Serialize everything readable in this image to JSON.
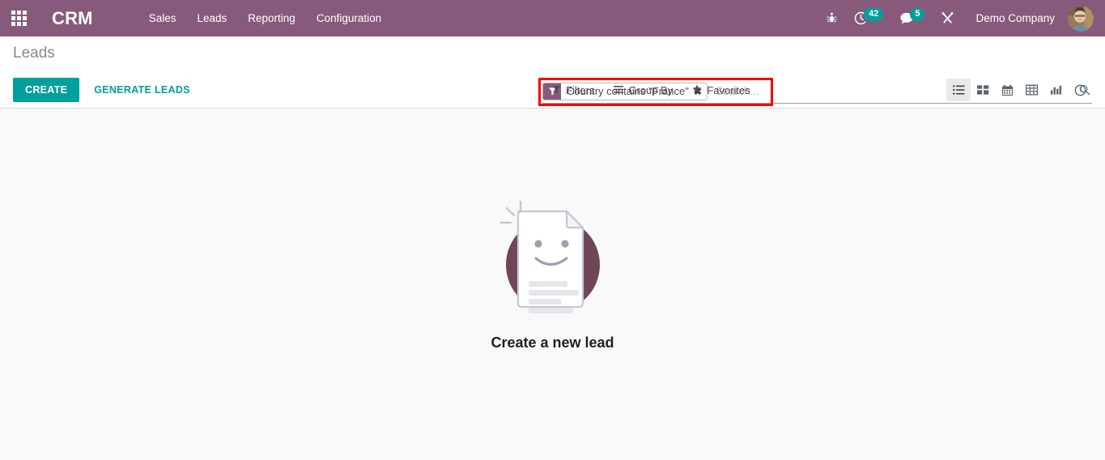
{
  "navbar": {
    "apps_icon": "apps-grid-icon",
    "brand": "CRM",
    "menu": [
      {
        "label": "Sales"
      },
      {
        "label": "Leads"
      },
      {
        "label": "Reporting"
      },
      {
        "label": "Configuration"
      }
    ],
    "systray": {
      "debug_icon": "bug-icon",
      "activity_icon": "clock-icon",
      "activity_count": "42",
      "messaging_icon": "chat-bubble-icon",
      "messaging_count": "5",
      "tools_icon": "wrench-tools-icon",
      "company": "Demo Company",
      "avatar_icon": "user-avatar"
    },
    "background_color": "#875a7b",
    "badge_color": "#00a09d"
  },
  "control_panel": {
    "breadcrumb": "Leads",
    "buttons": {
      "create": "CREATE",
      "generate_leads": "GENERATE LEADS",
      "create_color": "#00a09d"
    },
    "search": {
      "facet": {
        "icon": "filter-funnel-icon",
        "label": "Country contains \"France\"",
        "remove": "✖",
        "icon_color": "#875a7b"
      },
      "placeholder": "Search...",
      "value": "",
      "search_icon": "magnifier-icon"
    },
    "filter_menus": [
      {
        "label": "Filters",
        "icon": "funnel-icon"
      },
      {
        "label": "Group By",
        "icon": "hamburger-lines-icon"
      },
      {
        "label": "Favorites",
        "icon": "star-icon"
      }
    ],
    "view_switcher": [
      {
        "name": "list",
        "icon": "list-view-icon",
        "active": true
      },
      {
        "name": "kanban",
        "icon": "kanban-view-icon",
        "active": false
      },
      {
        "name": "calendar",
        "icon": "calendar-view-icon",
        "active": false
      },
      {
        "name": "pivot",
        "icon": "pivot-view-icon",
        "active": false
      },
      {
        "name": "graph",
        "icon": "graph-view-icon",
        "active": false
      },
      {
        "name": "activity",
        "icon": "activity-clock-icon",
        "active": false
      }
    ]
  },
  "content": {
    "empty_state": {
      "illustration": "document-smiley-illustration",
      "text": "Create a new lead",
      "circle_color": "#6e4658"
    },
    "background_color": "#f9f9f9"
  },
  "annotation": {
    "highlight_color": "#f80000"
  }
}
